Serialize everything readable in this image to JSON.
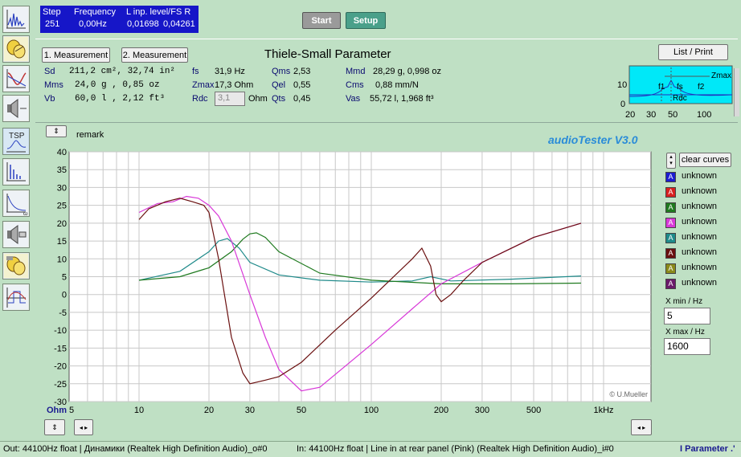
{
  "header": {
    "step_label": "Step",
    "step_value": "251",
    "freq_label": "Frequency",
    "freq_value": "0,00Hz",
    "level_label": "L inp. level/FS  R",
    "level_left": "0,01698",
    "level_right": "0,04261"
  },
  "toolbar": {
    "start_label": "Start",
    "setup_label": "Setup",
    "list_print_label": "List / Print"
  },
  "tabs": [
    "1. Measurement",
    "2. Measurement"
  ],
  "title": "Thiele-Small Parameter",
  "params": {
    "sd_label": "Sd",
    "sd_value": "211,2 cm², 32,74 in²",
    "mms_label": "Mms",
    "mms_value": "24,0 g  , 0,85 oz",
    "vb_label": "Vb",
    "vb_value": "60,0 l  , 2,12 ft³",
    "fs_label": "fs",
    "fs_value": "31,9 Hz",
    "zmax_label": "Zmax",
    "zmax_value": "17,3 Ohm",
    "rdc_label": "Rdc",
    "rdc_value": "3,1",
    "rdc_unit": "Ohm",
    "qms_label": "Qms",
    "qms_value": "2,53",
    "qel_label": "Qel",
    "qel_value": "0,55",
    "qts_label": "Qts",
    "qts_value": "0,45",
    "mmd_label": "Mmd",
    "mmd_value": "28,29 g, 0,998 oz",
    "cms_label": "Cms",
    "cms_value": "0,88 mm/N",
    "vas_label": "Vas",
    "vas_value": "55,72 l, 1,968 ft³"
  },
  "mini_plot": {
    "labels": [
      "Zmax",
      "f1",
      "fs",
      "f2",
      "Rdc"
    ],
    "y_ticks": [
      "10",
      "0"
    ],
    "x_ticks": [
      "20",
      "30",
      "50",
      "100"
    ]
  },
  "sidebar_top": [
    "waveform-icon",
    "speaker-parts-icon",
    "spectrum-icon",
    "speaker-icon"
  ],
  "sidebar_bottom": [
    {
      "name": "tsp",
      "label": "TSP"
    },
    {
      "name": "frequency-response",
      "label": ""
    },
    {
      "name": "impedance",
      "label": ""
    },
    {
      "name": "speaker-measure",
      "label": ""
    },
    {
      "name": "speaker-parts-2",
      "label": ""
    },
    {
      "name": "step-response",
      "label": ""
    }
  ],
  "plot": {
    "remark": "remark",
    "brand": "audioTester  V3.0",
    "credit": "© U.Mueller",
    "y_unit": "Ohm",
    "colors": {
      "bg": "#ffffff",
      "grid": "#c8c8c8",
      "brand": "#2a8cd8"
    }
  },
  "legend": {
    "clear_label": "clear curves",
    "items": [
      {
        "label": "unknown",
        "color": "#1c1cd0"
      },
      {
        "label": "unknown",
        "color": "#d82020"
      },
      {
        "label": "unknown",
        "color": "#1f7a1f"
      },
      {
        "label": "unknown",
        "color": "#d838d8"
      },
      {
        "label": "unknown",
        "color": "#1f8a8a"
      },
      {
        "label": "unknown",
        "color": "#6a0f0f"
      },
      {
        "label": "unknown",
        "color": "#8a8a1a"
      },
      {
        "label": "unknown",
        "color": "#6a1a6a"
      }
    ],
    "xmin_label": "X min / Hz",
    "xmin_value": "5",
    "xmax_label": "X max / Hz",
    "xmax_value": "1600"
  },
  "status": {
    "out": "Out: 44100Hz float  | Динамики (Realtek High Definition Audio)_o#0",
    "in": "In: 44100Hz float  | Line in at rear panel (Pink) (Realtek High Definition Audio)_i#0",
    "right": "I Parameter .'"
  },
  "chart_data": {
    "type": "line",
    "xlabel": "",
    "ylabel": "Ohm",
    "x_scale": "log",
    "xlim": [
      5,
      1600
    ],
    "ylim": [
      -30,
      40
    ],
    "x_ticks": [
      5,
      10,
      20,
      30,
      50,
      100,
      200,
      300,
      500,
      1000
    ],
    "x_tick_labels": [
      "5",
      "10",
      "20",
      "30",
      "50",
      "100",
      "200",
      "300",
      "500",
      "1kHz"
    ],
    "y_ticks": [
      40,
      35,
      30,
      25,
      20,
      15,
      10,
      5,
      0,
      -5,
      -10,
      -15,
      -20,
      -25,
      -30
    ],
    "grid": true,
    "series": [
      {
        "color": "#1f8a8a",
        "x": [
          10,
          15,
          20,
          22,
          24,
          27,
          30,
          40,
          60,
          100,
          150,
          180,
          220,
          400,
          800
        ],
        "y": [
          4,
          6.5,
          12,
          15,
          15.7,
          13,
          9,
          5.5,
          4,
          3.5,
          3.8,
          5,
          3.8,
          4.3,
          5.2
        ]
      },
      {
        "color": "#1f7a1f",
        "x": [
          10,
          15,
          20,
          25,
          28,
          30,
          32,
          35,
          40,
          60,
          100,
          200,
          400,
          800
        ],
        "y": [
          4,
          5,
          7.5,
          12,
          15.5,
          17,
          17.3,
          16,
          12,
          6,
          4,
          3,
          3,
          3.2
        ]
      },
      {
        "color": "#d838d8",
        "x": [
          10,
          12,
          14,
          16,
          18,
          20,
          22,
          25,
          30,
          35,
          40,
          50,
          60,
          100,
          150,
          200,
          300,
          500,
          800
        ],
        "y": [
          23,
          25.5,
          26,
          27.5,
          27,
          25,
          22,
          15,
          0,
          -12,
          -21,
          -27,
          -26,
          -14,
          -4,
          3,
          9,
          16,
          20
        ]
      },
      {
        "color": "#6a0f0f",
        "x": [
          10,
          11,
          13,
          15,
          17,
          19,
          20,
          22,
          25,
          28,
          30,
          35,
          40,
          50,
          70,
          100,
          150,
          165,
          180,
          190,
          200,
          220,
          250,
          300,
          500,
          800
        ],
        "y": [
          21,
          24,
          26,
          27,
          26,
          25,
          23,
          10,
          -12,
          -22,
          -25,
          -24,
          -23,
          -19,
          -10,
          -1,
          10,
          13,
          8,
          0,
          -2,
          0,
          4,
          9,
          16,
          20
        ]
      }
    ]
  }
}
